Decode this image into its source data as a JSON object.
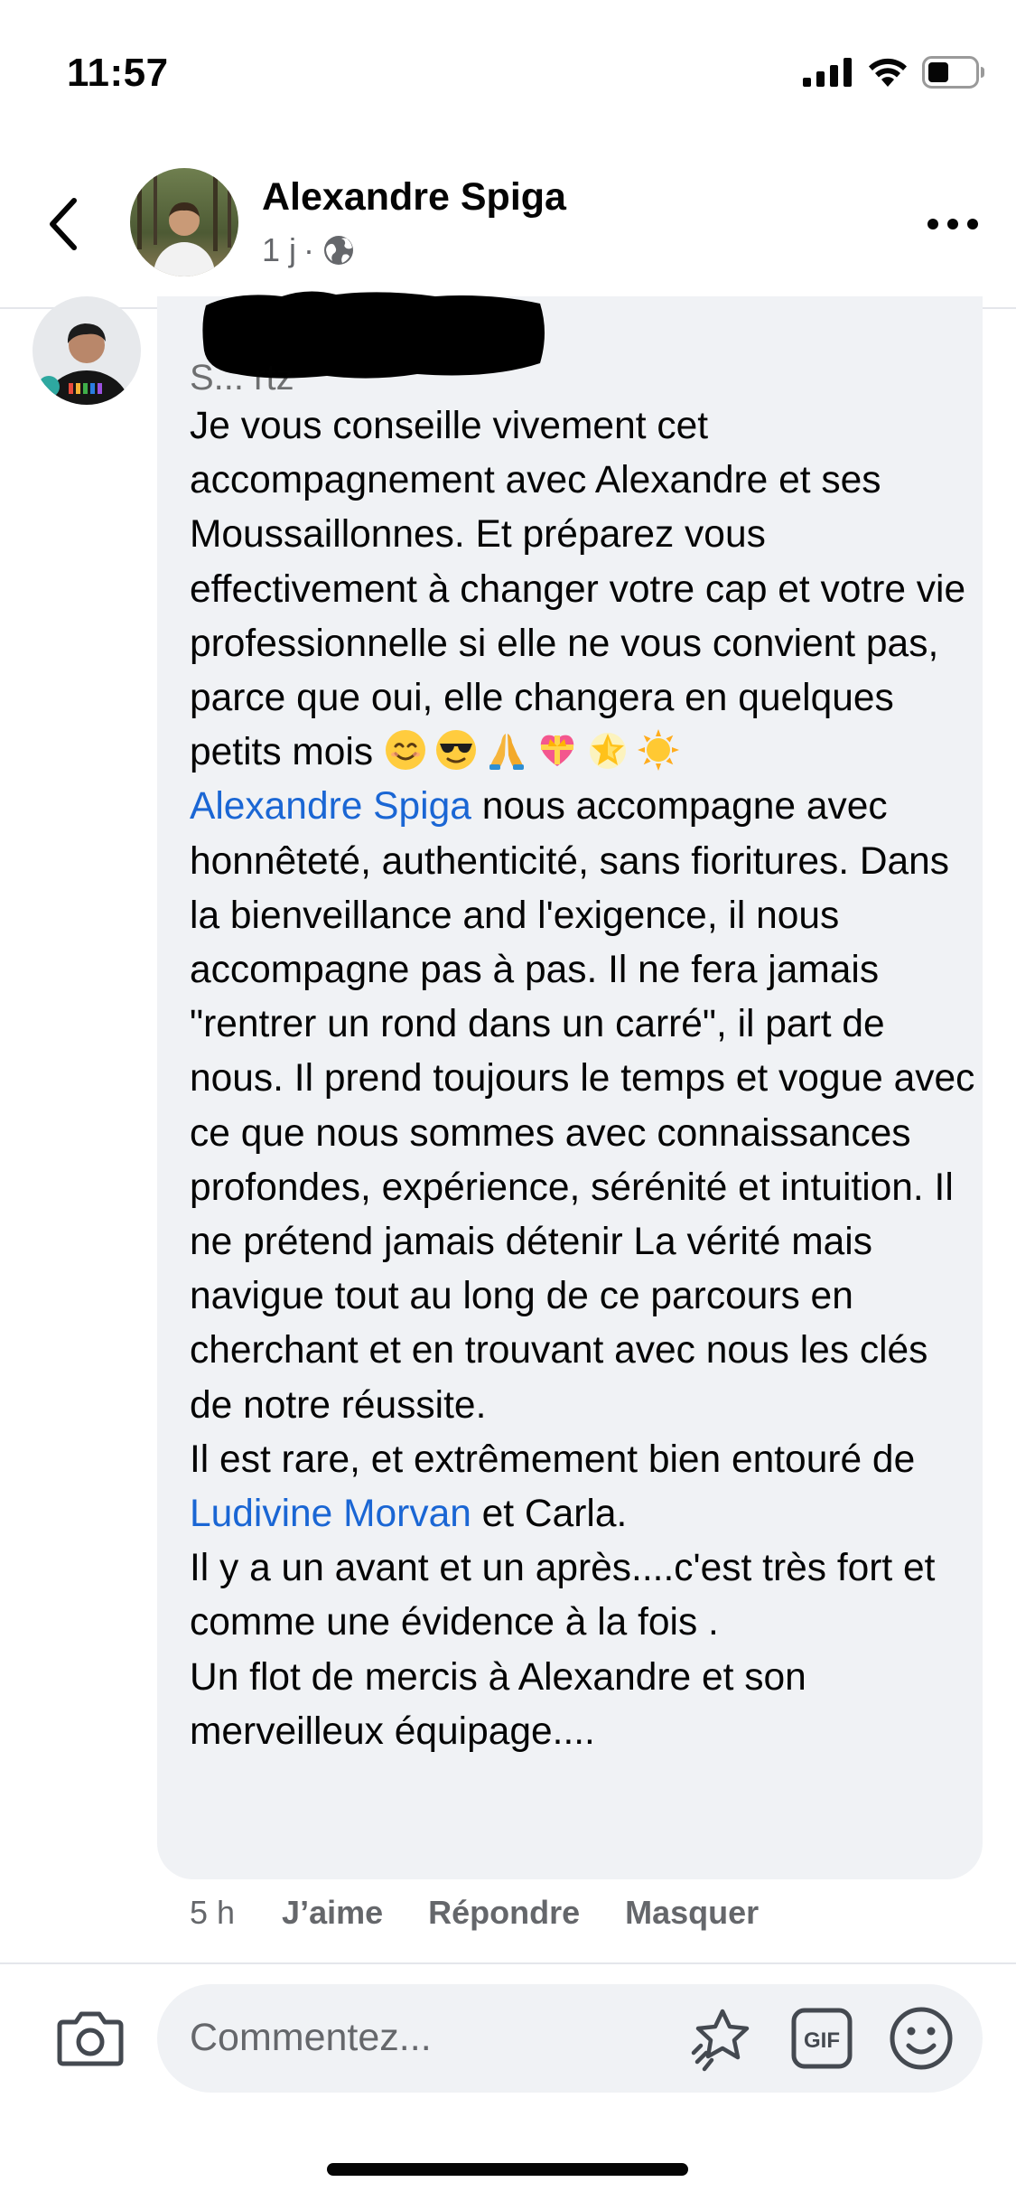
{
  "status_bar": {
    "time": "11:57",
    "icons": [
      "signal-icon",
      "wifi-icon",
      "battery-icon"
    ]
  },
  "header": {
    "author_name": "Alexandre Spiga",
    "post_age": "1 j",
    "separator": "·",
    "audience_icon": "globe-icon"
  },
  "comment": {
    "author_visible": "S...        rtz",
    "paragraphs": [
      {
        "segments": [
          {
            "type": "text",
            "value": "Je vous conseille vivement cet accompagnement avec Alexandre et ses Moussaillonnes. Et préparez vous effectivement à changer votre cap et votre vie professionnelle si elle ne vous convient pas, parce que oui, elle changera en quelques petits mois "
          },
          {
            "type": "emoji",
            "value": "smiling-face-emoji"
          },
          {
            "type": "emoji",
            "value": "sunglasses-face-emoji"
          },
          {
            "type": "emoji",
            "value": "folded-hands-emoji"
          },
          {
            "type": "emoji",
            "value": "heart-ribbon-emoji"
          },
          {
            "type": "emoji",
            "value": "glowing-star-emoji"
          },
          {
            "type": "emoji",
            "value": "sun-emoji"
          }
        ]
      },
      {
        "segments": [
          {
            "type": "mention",
            "value": "Alexandre Spiga"
          },
          {
            "type": "text",
            "value": " nous accompagne avec honnêteté, authenticité, sans fioritures. Dans la bienveillance and l'exigence, il nous accompagne pas à pas. Il ne fera jamais \"rentrer un rond dans un carré\", il part de nous. Il prend toujours le temps et vogue avec ce que nous sommes avec connaissances profondes, expérience, sérénité et intuition. Il ne prétend jamais détenir La vérité mais navigue tout au long de ce parcours en cherchant et en trouvant avec nous les clés de notre réussite."
          }
        ]
      },
      {
        "segments": [
          {
            "type": "text",
            "value": "Il est rare, et extrêmement bien entouré de "
          },
          {
            "type": "mention",
            "value": "Ludivine Morvan"
          },
          {
            "type": "text",
            "value": " et Carla."
          }
        ]
      },
      {
        "segments": [
          {
            "type": "text",
            "value": "Il y a un avant et un après....c'est très fort et comme une évidence à la fois ."
          }
        ]
      },
      {
        "segments": [
          {
            "type": "text",
            "value": "Un flot de mercis à Alexandre et son merveilleux équipage...."
          }
        ]
      }
    ]
  },
  "comment_actions": {
    "time": "5 h",
    "like": "J’aime",
    "reply": "Répondre",
    "hide": "Masquer"
  },
  "composer": {
    "placeholder": "Commentez..."
  },
  "colors": {
    "mention": "#1a66d4",
    "bubble": "#f0f2f5",
    "secondary_text": "#65676b"
  }
}
